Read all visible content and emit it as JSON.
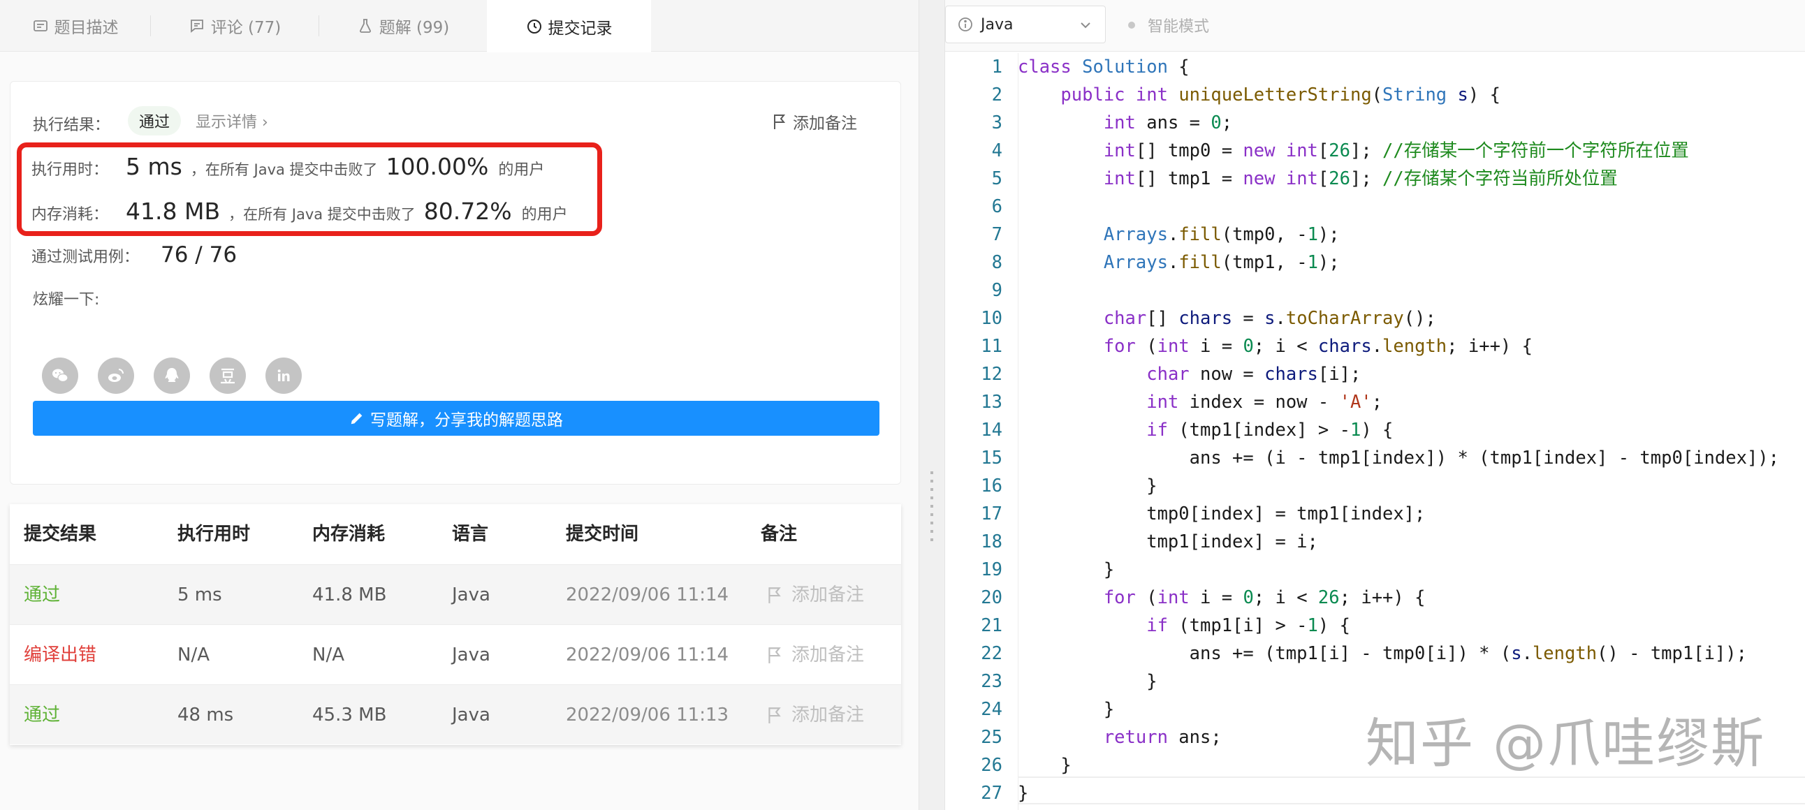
{
  "tabs": [
    {
      "label": "题目描述",
      "icon": "description-icon"
    },
    {
      "label": "评论 (77)",
      "icon": "comment-icon"
    },
    {
      "label": "题解 (99)",
      "icon": "flask-icon"
    },
    {
      "label": "提交记录",
      "icon": "clock-icon",
      "active": true
    }
  ],
  "result": {
    "label": "执行结果：",
    "status": "通过",
    "detail_link": "显示详情 ›",
    "add_note": "添加备注",
    "runtime_label": "执行用时：",
    "runtime_value": "5 ms",
    "runtime_mid": "，在所有 Java 提交中击败了",
    "runtime_pct": "100.00%",
    "runtime_tail": "的用户",
    "memory_label": "内存消耗：",
    "memory_value": "41.8 MB",
    "memory_mid": "，在所有 Java 提交中击败了",
    "memory_pct": "80.72%",
    "memory_tail": "的用户",
    "tests_label": "通过测试用例：",
    "tests_value": "76 / 76",
    "share_label": "炫耀一下:",
    "share_icons": [
      "wechat-icon",
      "weibo-icon",
      "qq-icon",
      "douban-icon",
      "linkedin-icon"
    ],
    "solution_button": "写题解，分享我的解题思路"
  },
  "table": {
    "headers": [
      "提交结果",
      "执行用时",
      "内存消耗",
      "语言",
      "提交时间",
      "备注"
    ],
    "rows": [
      {
        "status": "通过",
        "status_kind": "ok",
        "runtime": "5 ms",
        "memory": "41.8 MB",
        "lang": "Java",
        "time": "2022/09/06 11:14",
        "note": "添加备注"
      },
      {
        "status": "编译出错",
        "status_kind": "err",
        "runtime": "N/A",
        "memory": "N/A",
        "lang": "Java",
        "time": "2022/09/06 11:14",
        "note": "添加备注"
      },
      {
        "status": "通过",
        "status_kind": "ok",
        "runtime": "48 ms",
        "memory": "45.3 MB",
        "lang": "Java",
        "time": "2022/09/06 11:13",
        "note": "添加备注"
      }
    ]
  },
  "editor": {
    "language": "Java",
    "mode": "智能模式",
    "line_numbers": [
      "1",
      "2",
      "3",
      "4",
      "5",
      "6",
      "7",
      "8",
      "9",
      "10",
      "11",
      "12",
      "13",
      "14",
      "15",
      "16",
      "17",
      "18",
      "19",
      "20",
      "21",
      "22",
      "23",
      "24",
      "25",
      "26",
      "27"
    ],
    "lines": [
      "class Solution {",
      "    public int uniqueLetterString(String s) {",
      "        int ans = 0;",
      "        int[] tmp0 = new int[26]; //存储某一个字符前一个字符所在位置",
      "        int[] tmp1 = new int[26]; //存储某个字符当前所处位置",
      "",
      "        Arrays.fill(tmp0, -1);",
      "        Arrays.fill(tmp1, -1);",
      "",
      "        char[] chars = s.toCharArray();",
      "        for (int i = 0; i < chars.length; i++) {",
      "            char now = chars[i];",
      "            int index = now - 'A';",
      "            if (tmp1[index] > -1) {",
      "                ans += (i - tmp1[index]) * (tmp1[index] - tmp0[index]);",
      "            }",
      "            tmp0[index] = tmp1[index];",
      "            tmp1[index] = i;",
      "        }",
      "        for (int i = 0; i < 26; i++) {",
      "            if (tmp1[i] > -1) {",
      "                ans += (tmp1[i] - tmp0[i]) * (s.length() - tmp1[i]);",
      "            }",
      "        }",
      "        return ans;",
      "    }",
      "}"
    ]
  },
  "watermark": "知乎 @爪哇缪斯",
  "colors": {
    "accent": "#1890ff",
    "pass": "#5fb236",
    "error": "#e0403b",
    "highlight_box": "#e8211b"
  }
}
